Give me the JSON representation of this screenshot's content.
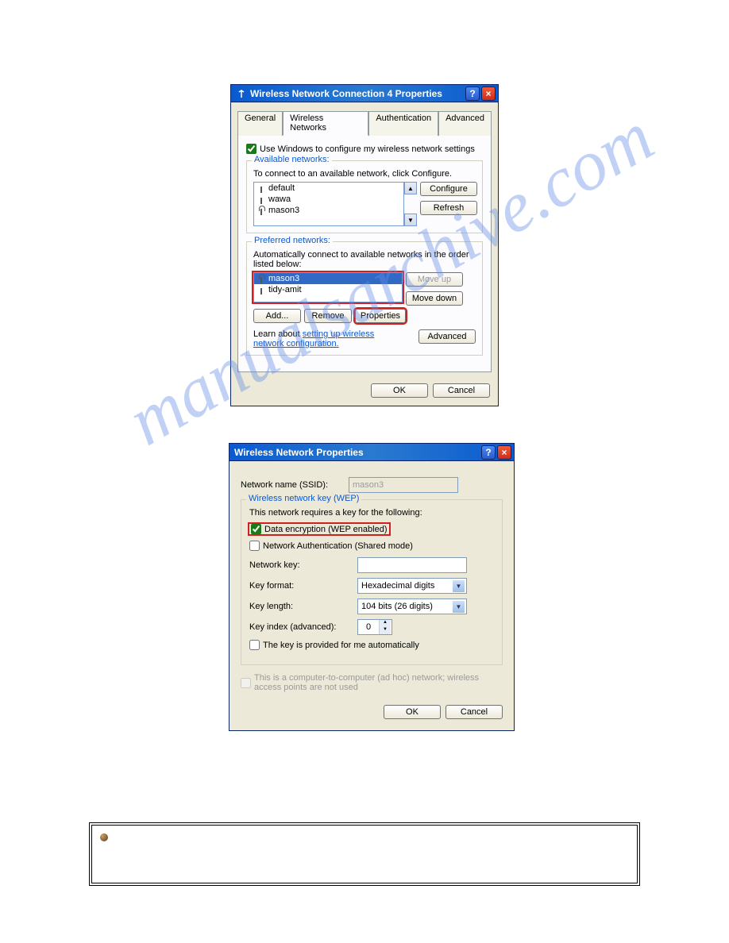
{
  "watermark": "manualsarchive.com",
  "dialog1": {
    "title": "Wireless Network Connection 4 Properties",
    "tabs": [
      "General",
      "Wireless Networks",
      "Authentication",
      "Advanced"
    ],
    "active_tab": 1,
    "use_windows_label": "Use Windows to configure my wireless network settings",
    "available": {
      "legend": "Available networks:",
      "hint": "To connect to an available network, click Configure.",
      "items": [
        "default",
        "wawa",
        "mason3"
      ],
      "configure": "Configure",
      "refresh": "Refresh"
    },
    "preferred": {
      "legend": "Preferred networks:",
      "hint": "Automatically connect to available networks in the order listed below:",
      "items": [
        "mason3",
        "tidy-amit"
      ],
      "moveup": "Move up",
      "movedown": "Move down",
      "add": "Add...",
      "remove": "Remove",
      "properties": "Properties",
      "learn_prefix": "Learn about ",
      "learn_link": "setting up wireless network configuration.",
      "advanced": "Advanced"
    },
    "ok": "OK",
    "cancel": "Cancel"
  },
  "dialog2": {
    "title": "Wireless Network Properties",
    "ssid_label": "Network name (SSID):",
    "ssid_value": "mason3",
    "wep_legend": "Wireless network key (WEP)",
    "requires_label": "This network requires a key for the following:",
    "data_enc_label": "Data encryption (WEP enabled)",
    "net_auth_label": "Network Authentication (Shared mode)",
    "net_key_label": "Network key:",
    "key_format_label": "Key format:",
    "key_format_value": "Hexadecimal digits",
    "key_length_label": "Key length:",
    "key_length_value": "104 bits (26 digits)",
    "key_index_label": "Key index (advanced):",
    "key_index_value": "0",
    "auto_key_label": "The key is provided for me automatically",
    "adhoc_label": "This is a computer-to-computer (ad hoc) network; wireless access points are not used",
    "ok": "OK",
    "cancel": "Cancel"
  }
}
